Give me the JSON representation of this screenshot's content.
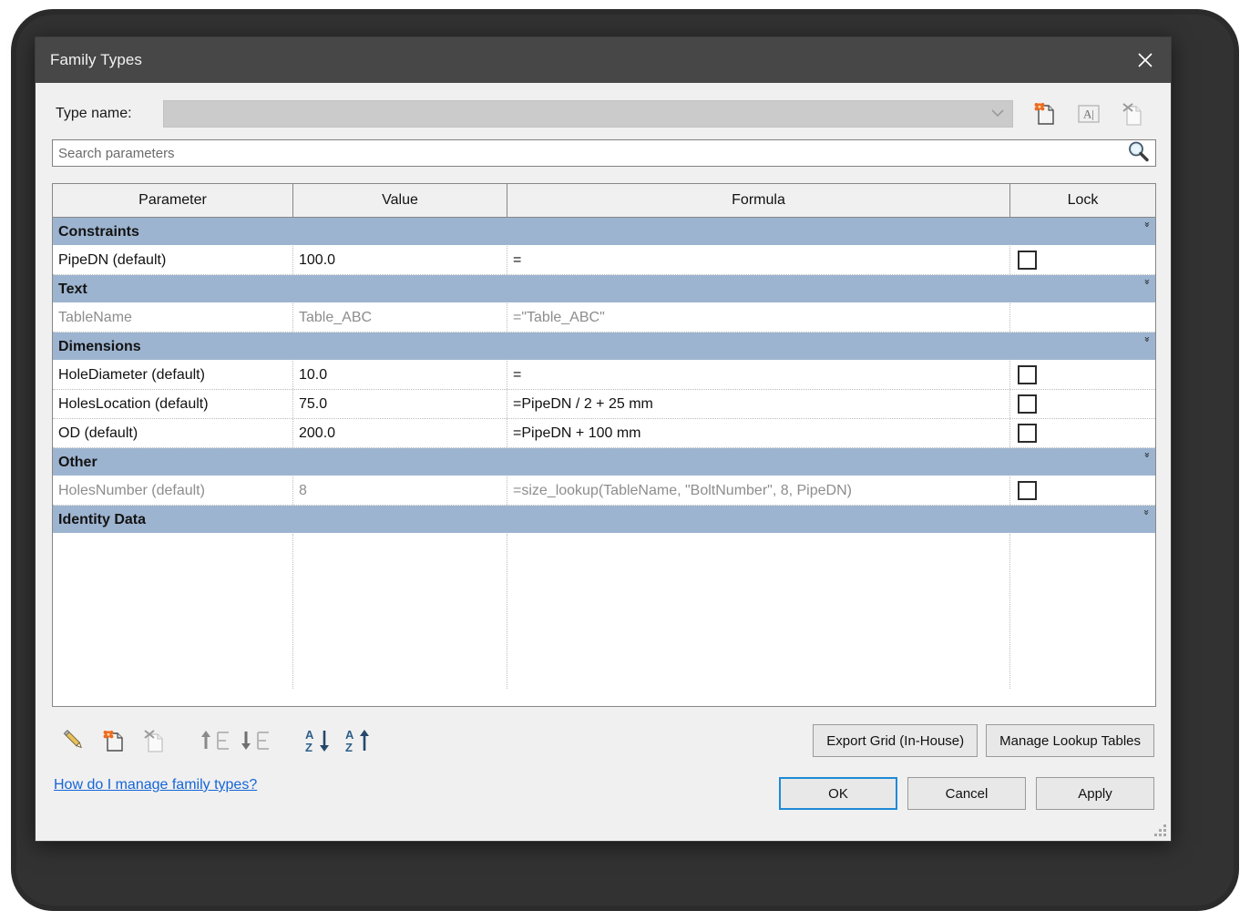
{
  "window": {
    "title": "Family Types",
    "close_icon": "close-icon"
  },
  "type_row": {
    "label": "Type name:",
    "combo_value": "",
    "combo_placeholder": "",
    "dropdown_icon": "chevron-down-icon",
    "icons": [
      {
        "name": "new-type-icon",
        "tooltip": "New Type"
      },
      {
        "name": "rename-type-icon",
        "tooltip": "Rename",
        "glyph": "A|"
      },
      {
        "name": "delete-type-icon",
        "tooltip": "Delete Type"
      }
    ]
  },
  "search": {
    "placeholder": "Search parameters",
    "value": "Search parameters",
    "icon": "search-icon"
  },
  "grid": {
    "columns": [
      "Parameter",
      "Value",
      "Formula",
      "Lock"
    ],
    "groups": [
      {
        "label": "Constraints",
        "collapsed": false,
        "chevron": "chevron-double-up-icon",
        "rows": [
          {
            "parameter": "PipeDN (default)",
            "value": "100.0",
            "formula": "=",
            "lock": true,
            "dimmed": false
          }
        ]
      },
      {
        "label": "Text",
        "collapsed": false,
        "chevron": "chevron-double-up-icon",
        "rows": [
          {
            "parameter": "TableName",
            "value": "Table_ABC",
            "formula": "=\"Table_ABC\"",
            "lock": false,
            "dimmed": true
          }
        ]
      },
      {
        "label": "Dimensions",
        "collapsed": false,
        "chevron": "chevron-double-up-icon",
        "rows": [
          {
            "parameter": "HoleDiameter (default)",
            "value": "10.0",
            "formula": "=",
            "lock": true,
            "dimmed": false
          },
          {
            "parameter": "HolesLocation (default)",
            "value": "75.0",
            "formula": "=PipeDN / 2 + 25 mm",
            "lock": true,
            "dimmed": false
          },
          {
            "parameter": "OD (default)",
            "value": "200.0",
            "formula": "=PipeDN + 100 mm",
            "lock": true,
            "dimmed": false
          }
        ]
      },
      {
        "label": "Other",
        "collapsed": false,
        "chevron": "chevron-double-up-icon",
        "rows": [
          {
            "parameter": "HolesNumber (default)",
            "value": "8",
            "formula": "=size_lookup(TableName, \"BoltNumber\", 8, PipeDN)",
            "lock": true,
            "dimmed": true
          }
        ]
      },
      {
        "label": "Identity Data",
        "collapsed": true,
        "chevron": "chevron-double-down-icon",
        "rows": []
      }
    ]
  },
  "bottom_toolbar": [
    {
      "name": "edit-parameter-icon",
      "tooltip": "Modify"
    },
    {
      "name": "new-parameter-icon",
      "tooltip": "New Parameter"
    },
    {
      "name": "delete-parameter-icon",
      "tooltip": "Remove Parameter"
    },
    {
      "name": "move-up-icon",
      "tooltip": "Move Up",
      "glyph": "E"
    },
    {
      "name": "move-down-icon",
      "tooltip": "Move Down",
      "glyph": "E"
    },
    {
      "name": "sort-descending-icon",
      "tooltip": "Sort Descending"
    },
    {
      "name": "sort-ascending-icon",
      "tooltip": "Sort Ascending"
    }
  ],
  "help_link": "How do I manage family types?",
  "buttons": {
    "export_grid": "Export Grid (In-House)",
    "manage_lookup": "Manage Lookup Tables",
    "ok": "OK",
    "cancel": "Cancel",
    "apply": "Apply"
  },
  "colors": {
    "titlebar": "#474747",
    "group_header": "#9db4d0",
    "accent_focus": "#1e8ad6",
    "link": "#1565d8",
    "dialog_bg": "#f0f0f0"
  }
}
